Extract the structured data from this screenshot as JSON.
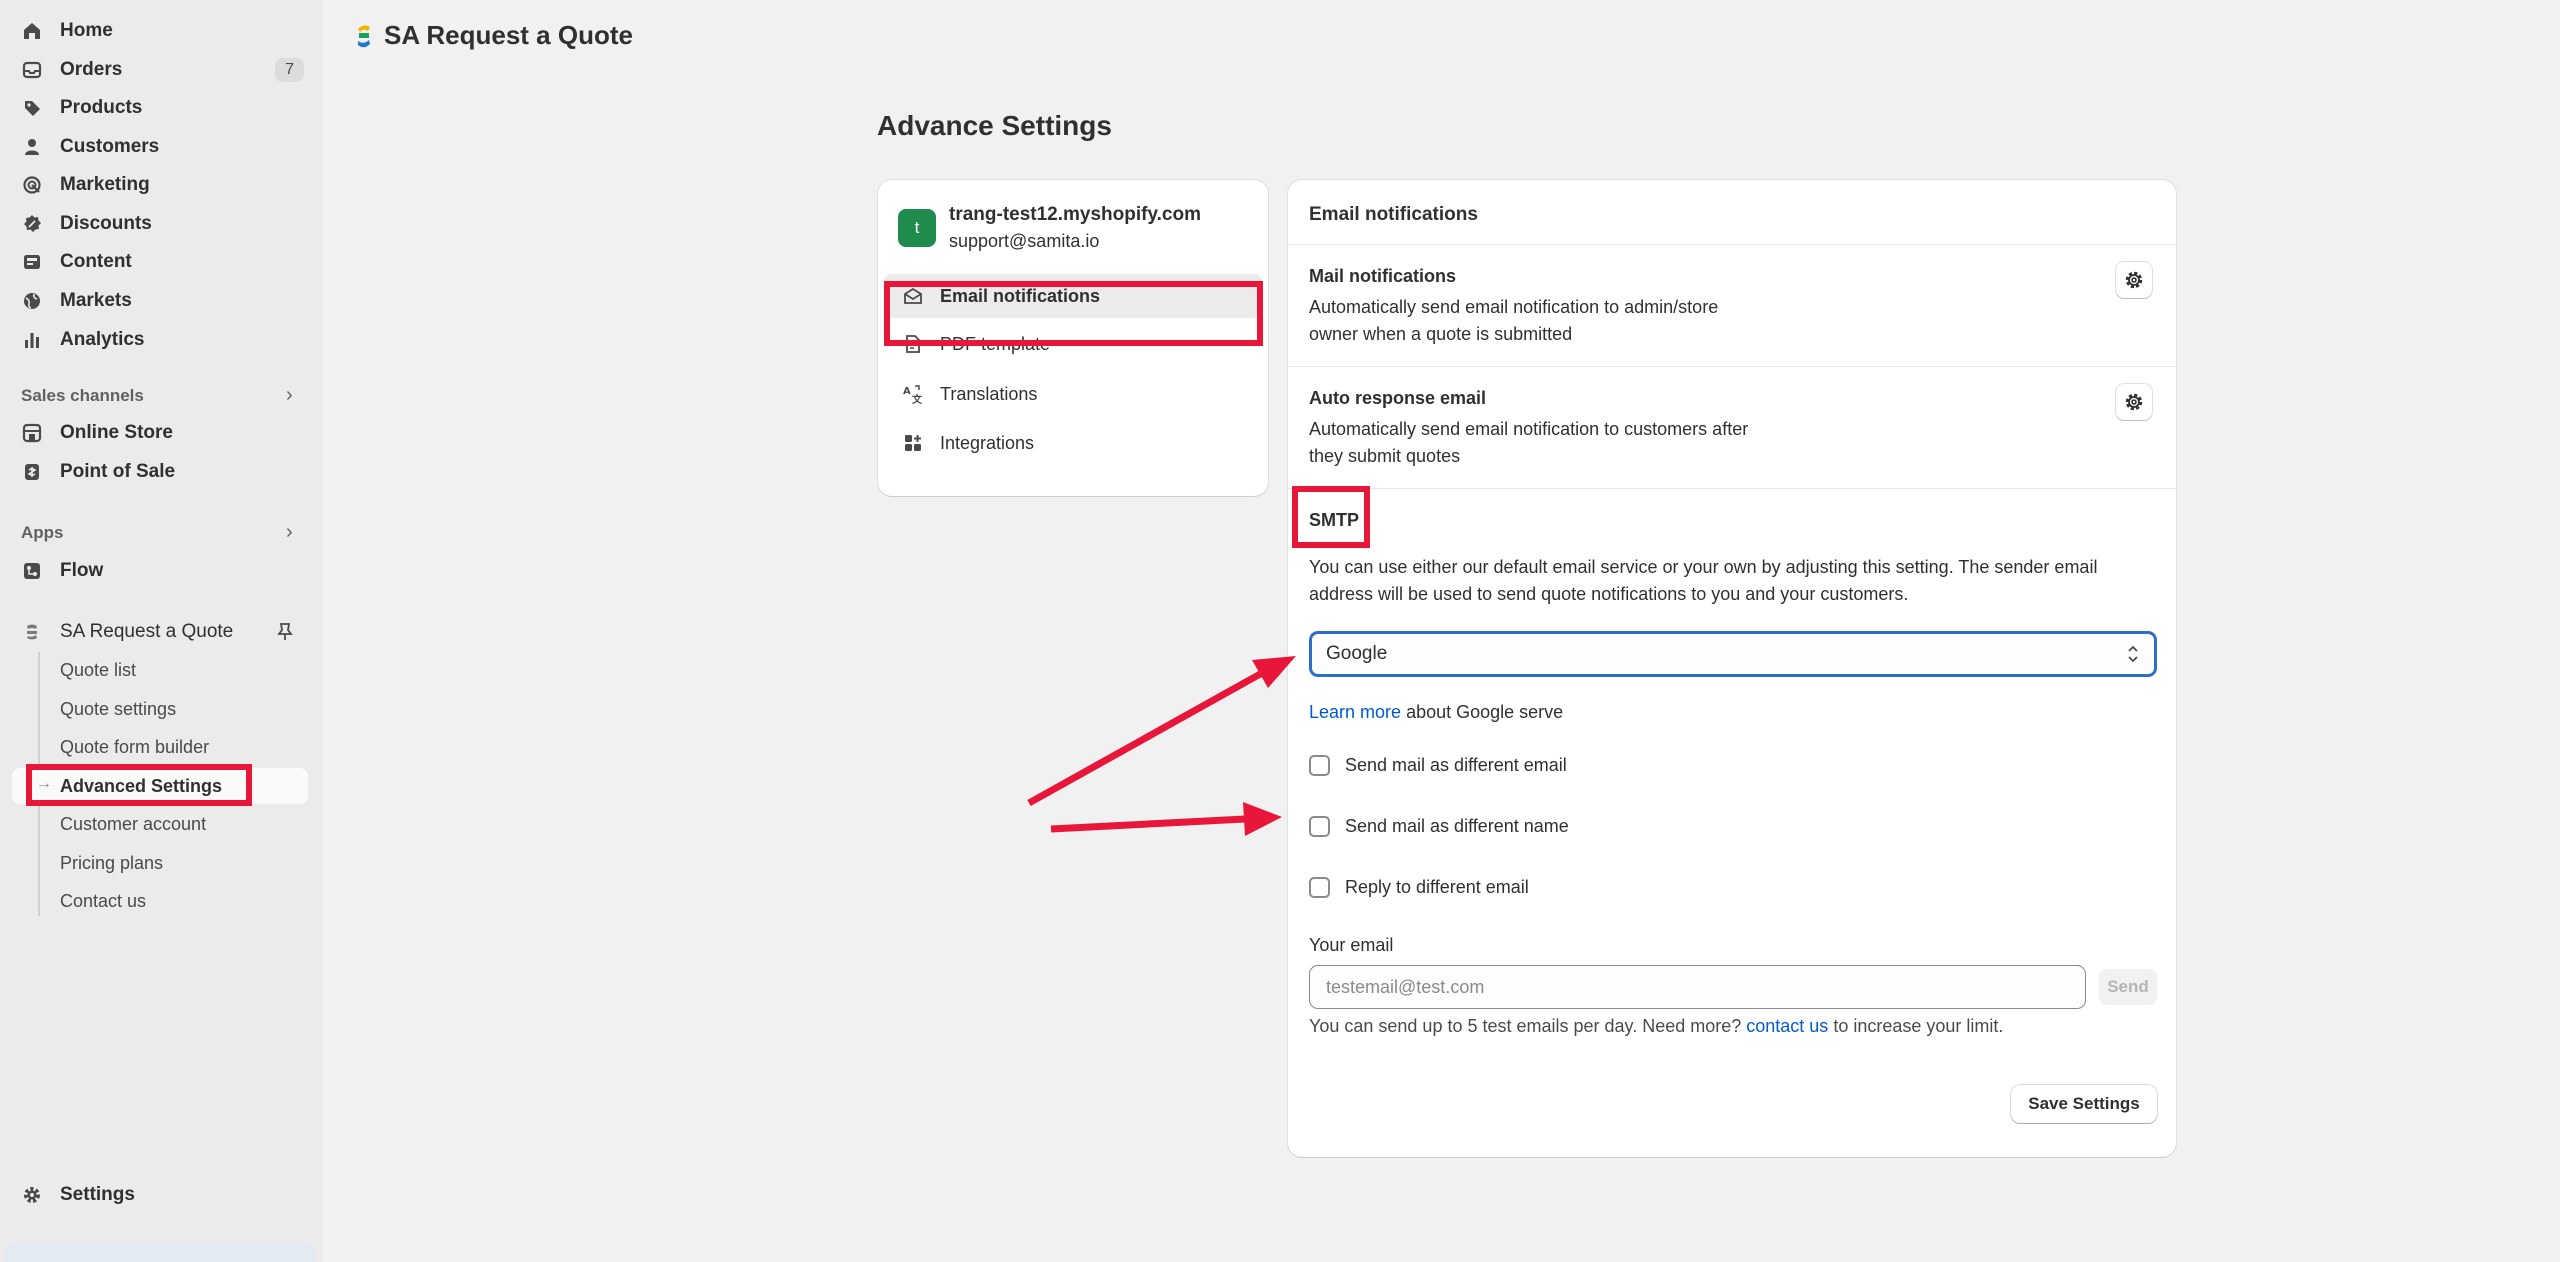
{
  "sidebar": {
    "nav": [
      {
        "label": "Home",
        "icon": "home-icon"
      },
      {
        "label": "Orders",
        "icon": "inbox-icon",
        "badge": "7"
      },
      {
        "label": "Products",
        "icon": "tag-icon"
      },
      {
        "label": "Customers",
        "icon": "person-icon"
      },
      {
        "label": "Marketing",
        "icon": "target-icon"
      },
      {
        "label": "Discounts",
        "icon": "discount-icon"
      },
      {
        "label": "Content",
        "icon": "content-icon"
      },
      {
        "label": "Markets",
        "icon": "globe-icon"
      },
      {
        "label": "Analytics",
        "icon": "bar-chart-icon"
      }
    ],
    "sales_channels_title": "Sales channels",
    "sales_channels": [
      {
        "label": "Online Store",
        "icon": "store-icon"
      },
      {
        "label": "Point of Sale",
        "icon": "pos-icon"
      }
    ],
    "apps_title": "Apps",
    "apps": [
      {
        "label": "Flow",
        "icon": "flow-icon"
      },
      {
        "label": "SA Request a Quote",
        "icon": "app-logo-icon"
      }
    ],
    "app_sub_items": [
      "Quote list",
      "Quote settings",
      "Quote form builder",
      "Advanced Settings",
      "Customer account",
      "Pricing plans",
      "Contact us"
    ],
    "settings_label": "Settings"
  },
  "header": {
    "app_title": "SA Request a Quote"
  },
  "page": {
    "title": "Advance Settings"
  },
  "store": {
    "avatar_letter": "t",
    "domain": "trang-test12.myshopify.com",
    "email": "support@samita.io"
  },
  "settings_menu": [
    {
      "label": "Email notifications",
      "icon": "mail-icon",
      "active": true
    },
    {
      "label": "PDF template",
      "icon": "file-icon"
    },
    {
      "label": "Translations",
      "icon": "translate-icon"
    },
    {
      "label": "Integrations",
      "icon": "apps-icon"
    }
  ],
  "email_card": {
    "title": "Email notifications",
    "mail_notifications": {
      "title": "Mail notifications",
      "desc_line1": "Automatically send email notification to admin/store",
      "desc_line2": "owner when a quote is submitted"
    },
    "auto_response": {
      "title": "Auto response email",
      "desc_line1": "Automatically send email notification to customers after",
      "desc_line2": "they submit quotes"
    },
    "smtp": {
      "title": "SMTP",
      "desc_line1": "You can use either our default email service or your own by adjusting this setting. The sender email",
      "desc_line2": "address will be used to send quote notifications to you and your customers.",
      "select_value": "Google",
      "learn_more_link": "Learn more",
      "learn_more_rest": " about Google serve"
    },
    "checkboxes": [
      {
        "label": "Send mail as different email",
        "checked": false
      },
      {
        "label": "Send mail as different name",
        "checked": false
      },
      {
        "label": "Reply to different email",
        "checked": false
      }
    ],
    "your_email_label": "Your email",
    "your_email_placeholder": "testemail@test.com",
    "send_label": "Send",
    "help_prefix": "You can send up to 5 test emails per day. Need more? ",
    "help_link": "contact us",
    "help_suffix": " to increase your limit.",
    "save_label": "Save Settings"
  },
  "colors": {
    "annotation_red": "#e8173a",
    "link_blue": "#005bd3",
    "focus_blue": "#2c6ecb",
    "avatar_green": "#1f8b4d"
  }
}
